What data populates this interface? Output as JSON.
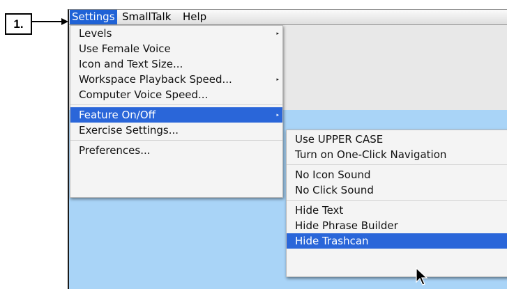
{
  "step_label": "1.",
  "menubar": {
    "items": [
      {
        "label": "Settings",
        "active": true
      },
      {
        "label": "SmallTalk",
        "active": false
      },
      {
        "label": "Help",
        "active": false
      }
    ]
  },
  "settings_menu": {
    "items": [
      {
        "label": "Levels",
        "submenu": true
      },
      {
        "label": "Use Female Voice",
        "submenu": false
      },
      {
        "label": "Icon and Text Size...",
        "submenu": false
      },
      {
        "label": "Workspace Playback Speed...",
        "submenu": true
      },
      {
        "label": "Computer Voice Speed...",
        "submenu": false
      },
      {
        "label": "Feature On/Off",
        "submenu": true,
        "selected": true
      },
      {
        "label": "Exercise Settings...",
        "submenu": false
      },
      {
        "label": "Preferences...",
        "submenu": false
      }
    ],
    "submenu_arrow": "▸"
  },
  "feature_submenu": {
    "items": [
      {
        "label": "Use UPPER CASE"
      },
      {
        "label": "Turn on One-Click Navigation"
      },
      {
        "label": "No Icon Sound"
      },
      {
        "label": "No Click Sound"
      },
      {
        "label": "Hide Text"
      },
      {
        "label": "Hide Phrase Builder"
      },
      {
        "label": "Hide Trashcan",
        "selected": true
      }
    ]
  },
  "colors": {
    "highlight": "#2a66d9",
    "workspace": "#a9d4f7"
  },
  "icons": {
    "step_arrow": "right-arrow-icon",
    "pointer": "mouse-pointer-icon"
  }
}
